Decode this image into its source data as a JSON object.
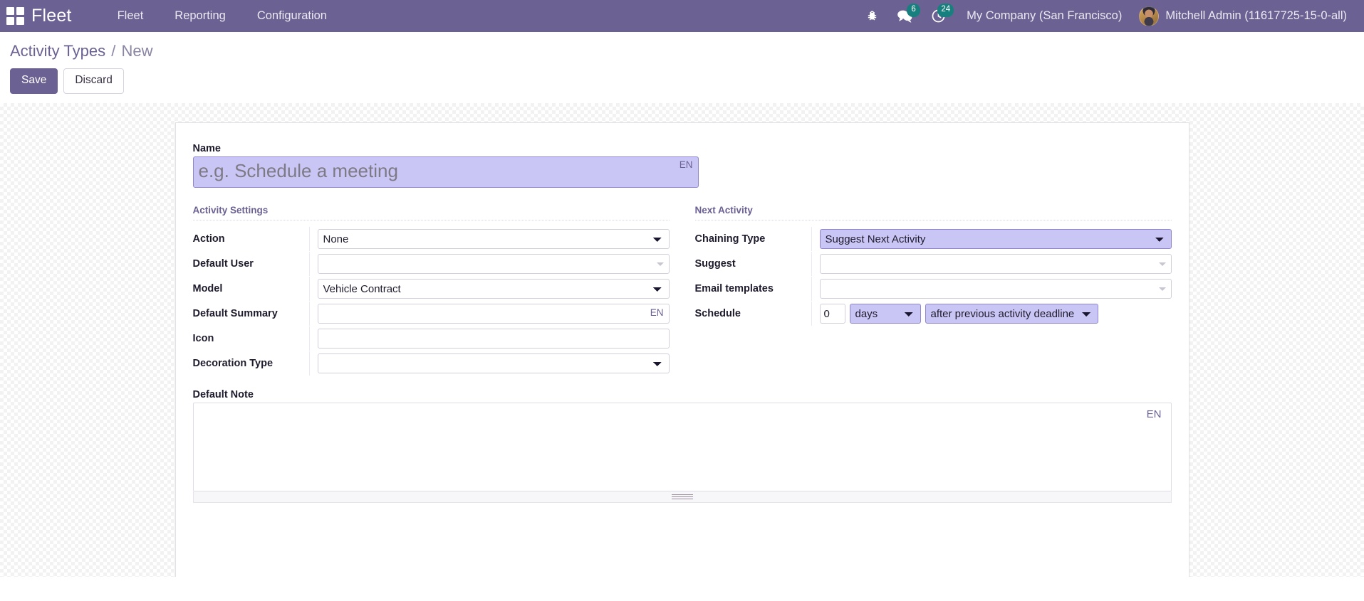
{
  "navbar": {
    "apps_icon": "apps-grid-icon",
    "brand": "Fleet",
    "menu": [
      {
        "label": "Fleet"
      },
      {
        "label": "Reporting"
      },
      {
        "label": "Configuration"
      }
    ],
    "bug_icon": "bug-icon",
    "messages": {
      "icon": "messages-icon",
      "count": "6"
    },
    "activities": {
      "icon": "activities-clock-icon",
      "count": "24"
    },
    "company": "My Company (San Francisco)",
    "user": "Mitchell Admin (11617725-15-0-all)",
    "avatar_icon": "user-avatar"
  },
  "control_panel": {
    "breadcrumb_root": "Activity Types",
    "breadcrumb_sep": "/",
    "breadcrumb_current": "New",
    "save_label": "Save",
    "discard_label": "Discard"
  },
  "form": {
    "name": {
      "label": "Name",
      "value": "",
      "placeholder": "e.g. Schedule a meeting",
      "lang": "EN"
    },
    "activity_settings": {
      "title": "Activity Settings",
      "action": {
        "label": "Action",
        "value": "None"
      },
      "default_user": {
        "label": "Default User",
        "value": "",
        "placeholder": ""
      },
      "model": {
        "label": "Model",
        "value": "Vehicle Contract"
      },
      "default_summary": {
        "label": "Default Summary",
        "value": "",
        "placeholder": "",
        "lang": "EN"
      },
      "icon": {
        "label": "Icon",
        "value": "",
        "placeholder": ""
      },
      "decoration_type": {
        "label": "Decoration Type",
        "value": ""
      }
    },
    "next_activity": {
      "title": "Next Activity",
      "chaining_type": {
        "label": "Chaining Type",
        "value": "Suggest Next Activity"
      },
      "suggest": {
        "label": "Suggest",
        "value": "",
        "placeholder": ""
      },
      "email_templates": {
        "label": "Email templates",
        "value": "",
        "placeholder": ""
      },
      "schedule": {
        "label": "Schedule",
        "amount": "0",
        "unit": "days",
        "relative_to": "after previous activity deadline"
      }
    },
    "default_note": {
      "label": "Default Note",
      "value": "",
      "placeholder": "",
      "lang": "EN"
    }
  },
  "colors": {
    "brand_purple": "#6b6192",
    "highlight_lavender": "#c9c6f5",
    "badge_teal": "#17807e"
  }
}
